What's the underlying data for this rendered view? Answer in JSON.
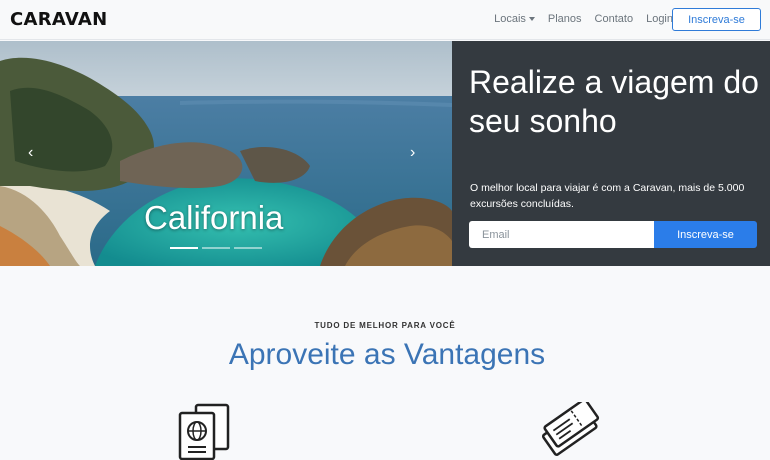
{
  "navbar": {
    "brand": "CARAVAN",
    "links": [
      {
        "label": "Locais",
        "has_dropdown": true
      },
      {
        "label": "Planos"
      },
      {
        "label": "Contato"
      },
      {
        "label": "Login"
      }
    ],
    "signup_button": "Inscreva-se"
  },
  "hero": {
    "carousel": {
      "caption": "California",
      "prev_icon": "chevron-left-icon",
      "next_icon": "chevron-right-icon"
    },
    "cta": {
      "title": "Realize a viagem do seu sonho",
      "text": "O melhor local para viajar é com a Caravan, mais de 5.000 excursões concluídas.",
      "email_placeholder": "Email",
      "email_value": "",
      "button": "Inscreva-se"
    }
  },
  "features": {
    "eyebrow": "TUDO DE MELHOR PARA VOCÊ",
    "title": "Aproveite as Vantagens",
    "icons": [
      "passport-icon",
      "tickets-icon"
    ]
  },
  "colors": {
    "accent": "#2b7de9",
    "dark_panel": "#343a40",
    "title_blue": "#3b74b5"
  }
}
